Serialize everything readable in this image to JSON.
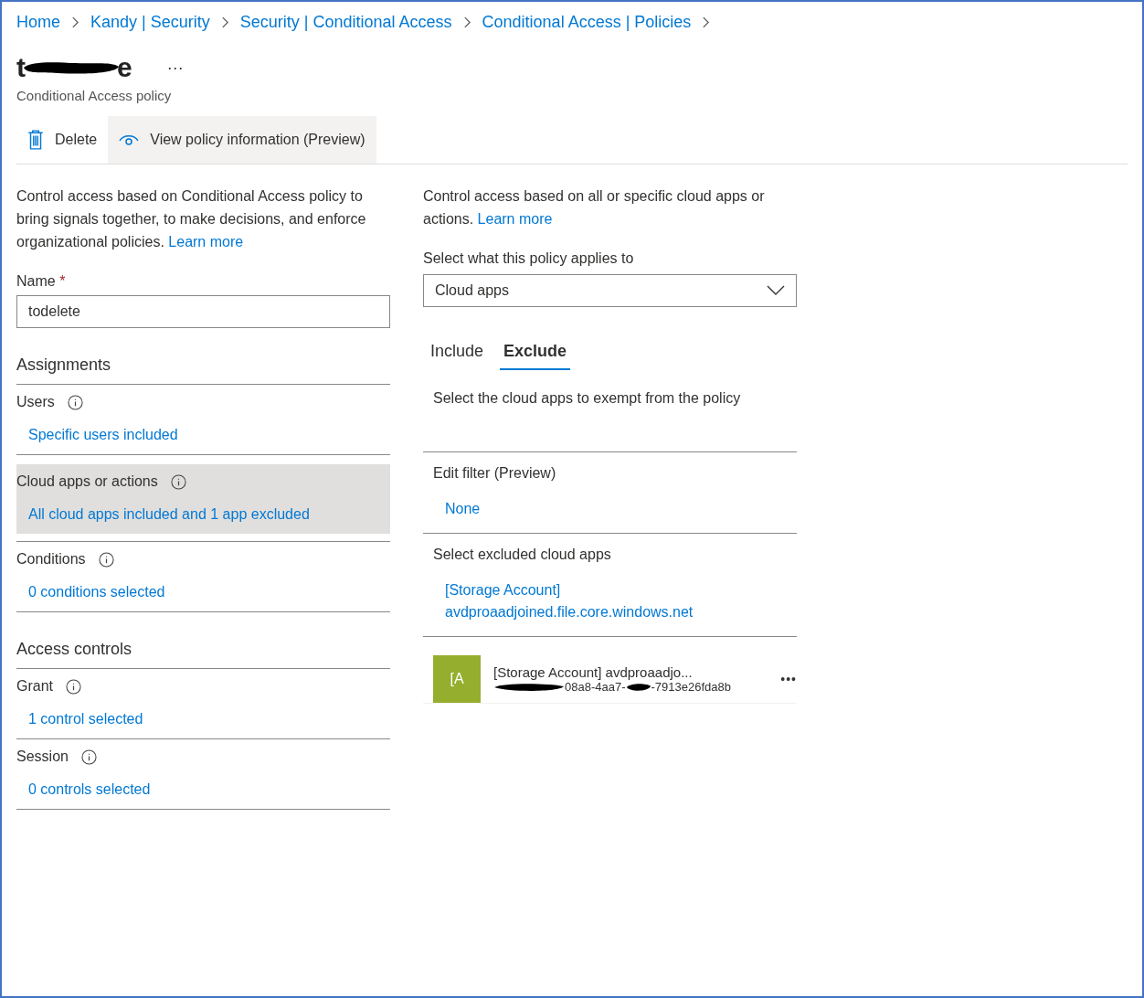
{
  "breadcrumb": [
    "Home",
    "Kandy | Security",
    "Security | Conditional Access",
    "Conditional Access | Policies"
  ],
  "title_parts": [
    "t",
    "e"
  ],
  "more": "···",
  "subtitle": "Conditional Access policy",
  "toolbar": [
    {
      "kind": "delete",
      "label": "Delete",
      "selected": false
    },
    {
      "kind": "view",
      "label": "View policy information (Preview)",
      "selected": true
    }
  ],
  "left": {
    "intro": "Control access based on Conditional Access policy to bring signals together, to make decisions, and enforce organizational policies.",
    "learn_more": "Learn more",
    "name_label": "Name",
    "required": "*",
    "name_value": "todelete",
    "sections": [
      {
        "heading": "Assignments",
        "items": [
          {
            "label": "Users",
            "value": "Specific users included",
            "selected": false
          },
          {
            "label": "Cloud apps or actions",
            "value": "All cloud apps included and 1 app excluded",
            "selected": true
          },
          {
            "label": "Conditions",
            "value": "0 conditions selected",
            "selected": false
          }
        ]
      },
      {
        "heading": "Access controls",
        "items": [
          {
            "label": "Grant",
            "value": "1 control selected",
            "selected": false
          },
          {
            "label": "Session",
            "value": "0 controls selected",
            "selected": false
          }
        ]
      }
    ]
  },
  "right": {
    "intro": "Control access based on all or specific cloud apps or actions.",
    "learn_more": "Learn more",
    "applies_label": "Select what this policy applies to",
    "applies_value": "Cloud apps",
    "tabs": [
      {
        "label": "Include",
        "selected": false
      },
      {
        "label": "Exclude",
        "selected": true
      }
    ],
    "exempt_text": "Select the cloud apps to exempt from the policy",
    "filter_label": "Edit filter (Preview)",
    "filter_value": "None",
    "excluded_label": "Select excluded cloud apps",
    "excluded_link": "[Storage Account] avdproaadjoined.file.core.windows.net",
    "apps": [
      {
        "initials": "[A",
        "color": "#95ae2e",
        "name": "[Storage Account] avdproaadjo...",
        "id_parts": [
          "08a8-4aa7-",
          "-7913e26fda8b"
        ],
        "more": "•••"
      }
    ]
  }
}
